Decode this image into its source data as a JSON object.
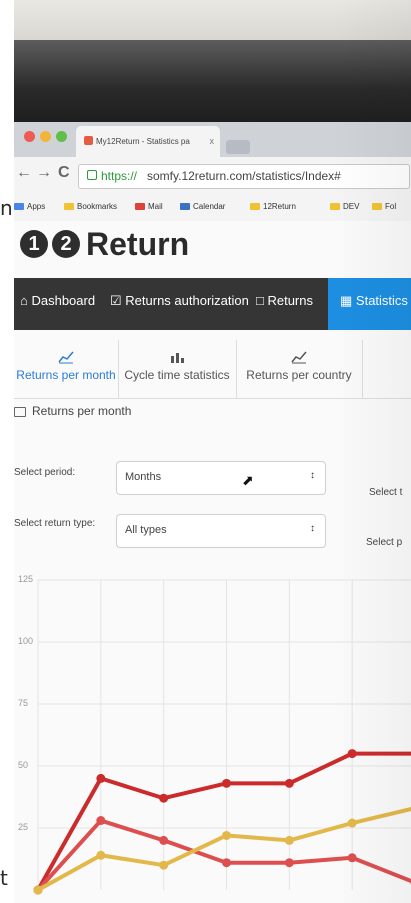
{
  "edge_text": {
    "left_char_1": "n",
    "left_char_2": "t"
  },
  "browser": {
    "tab_title": "My12Return - Statistics pa",
    "tab_close": "x",
    "nav_back": "←",
    "nav_forward": "→",
    "nav_reload": "C",
    "url_https": "https://",
    "url_rest": "somfy.12return.com/statistics/Index#",
    "bookmarks": [
      {
        "label": "Apps",
        "color": "#4a86e8"
      },
      {
        "label": "Bookmarks",
        "color": "#f1c232"
      },
      {
        "label": "Mail",
        "color": "#db4437"
      },
      {
        "label": "Calendar",
        "color": "#3d6fc3"
      },
      {
        "label": "12Return",
        "color": "#f1c232"
      },
      {
        "label": "DEV",
        "color": "#f1c232"
      },
      {
        "label": "Fol",
        "color": "#f1c232"
      }
    ],
    "traffic_lights": [
      "#ee5b53",
      "#f2b53a",
      "#5ec04a"
    ]
  },
  "app": {
    "logo_digits": [
      "1",
      "2"
    ],
    "logo_text": "Return",
    "nav": [
      {
        "label": "Dashboard",
        "icon": "home-icon"
      },
      {
        "label": "Returns authorization",
        "icon": "check-icon"
      },
      {
        "label": "Returns",
        "icon": "folder-icon"
      },
      {
        "label": "Statistics",
        "icon": "chart-icon",
        "active": true
      }
    ],
    "subtabs": [
      {
        "label": "Returns per month",
        "icon": "line-chart-icon",
        "active": true
      },
      {
        "label": "Cycle time statistics",
        "icon": "bar-chart-icon",
        "active": false
      },
      {
        "label": "Returns per country",
        "icon": "line-chart-icon",
        "active": false
      }
    ],
    "section_title": "Returns per month",
    "form": {
      "period_label": "Select period:",
      "period_value": "Months",
      "type_label": "Select return type:",
      "type_value": "All types",
      "right_label_1": "Select t",
      "right_label_2": "Select p",
      "arrow": "↕"
    },
    "accent_color": "#1d8ee1"
  },
  "chart_data": {
    "type": "line",
    "ylim": [
      0,
      125
    ],
    "yticks": [
      "125",
      "100",
      "75",
      "50",
      "25"
    ],
    "grid": true,
    "series": [
      {
        "color": "#cc2b2b",
        "values": [
          0,
          45,
          37,
          43,
          43,
          55,
          55
        ]
      },
      {
        "color": "#dd4f4f",
        "values": [
          0,
          28,
          20,
          11,
          11,
          13,
          3
        ]
      },
      {
        "color": "#e2b84a",
        "values": [
          0,
          14,
          10,
          22,
          20,
          27,
          33
        ]
      }
    ]
  }
}
